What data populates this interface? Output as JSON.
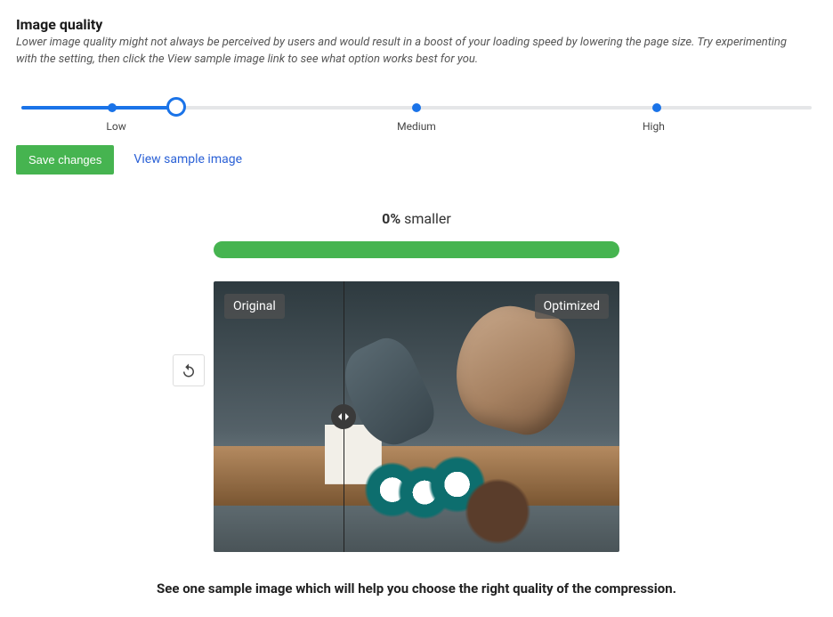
{
  "section": {
    "title": "Image quality",
    "description": "Lower image quality might not always be perceived by users and would result in a boost of your loading speed by lowering the page size. Try experimenting with the setting, then click the View sample image link to see what option works best for you."
  },
  "slider": {
    "value": "low",
    "labels": {
      "low": "Low",
      "medium": "Medium",
      "high": "High"
    }
  },
  "actions": {
    "save_label": "Save changes",
    "view_sample_label": "View sample image"
  },
  "preview": {
    "percent": "0%",
    "smaller_label": "smaller",
    "original_label": "Original",
    "optimized_label": "Optimized",
    "caption": "See one sample image which will help you choose the right quality of the compression."
  },
  "icons": {
    "reload": "reload-icon",
    "compare_handle": "compare-handle-icon"
  }
}
